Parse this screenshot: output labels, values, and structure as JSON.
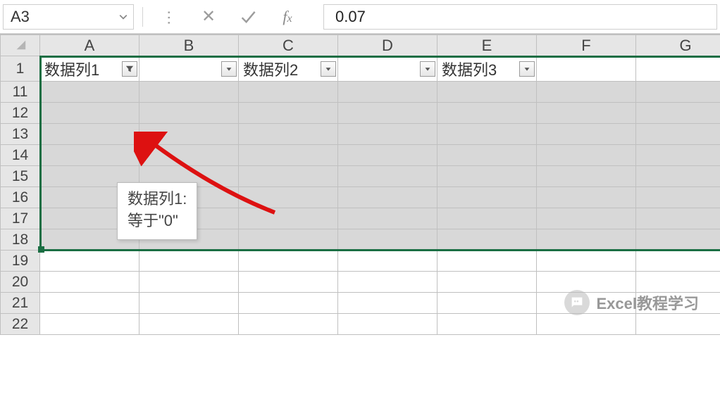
{
  "formula_bar": {
    "name_box": "A3",
    "formula_value": "0.07"
  },
  "columns": [
    "A",
    "B",
    "C",
    "D",
    "E",
    "F",
    "G"
  ],
  "row_headers": [
    1,
    11,
    12,
    13,
    14,
    15,
    16,
    17,
    18,
    19,
    20,
    21,
    22
  ],
  "header_cells": {
    "A": {
      "label": "数据列1",
      "filtered": true
    },
    "B": {
      "label": "",
      "filtered": false
    },
    "C": {
      "label": "数据列2",
      "filtered": false
    },
    "D": {
      "label": "",
      "filtered": false
    },
    "E": {
      "label": "数据列3",
      "filtered": false
    },
    "F": {
      "label": "",
      "filtered": false
    },
    "G": {
      "label": "",
      "filtered": false
    }
  },
  "tooltip": {
    "title": "数据列1:",
    "criteria": "等于\"0\""
  },
  "watermark": {
    "text": "Excel教程学习"
  },
  "selection": {
    "start_row_label": 1,
    "end_row_label": 18
  }
}
